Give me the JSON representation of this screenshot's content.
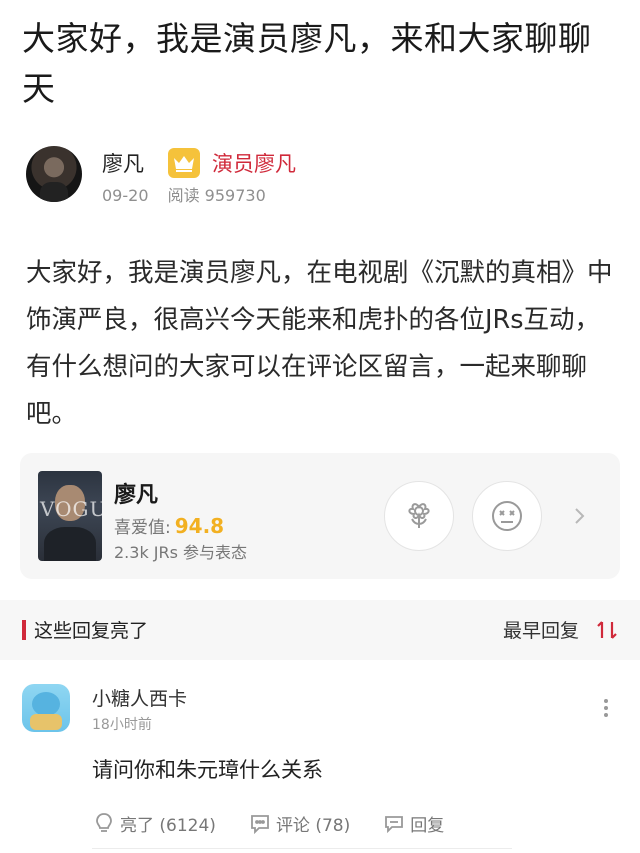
{
  "post": {
    "title": "大家好，我是演员廖凡，来和大家聊聊天",
    "author": {
      "name": "廖凡",
      "badge_icon": "crown-icon",
      "verified_title": "演员廖凡",
      "date": "09-20",
      "reads": "阅读 959730"
    },
    "body": "大家好，我是演员廖凡，在电视剧《沉默的真相》中饰演严良，很高兴今天能来和虎扑的各位JRs互动，有什么想问的大家可以在评论区留言，一起来聊聊吧。"
  },
  "rating_card": {
    "name": "廖凡",
    "like_label": "喜爱值:",
    "like_score": "94.8",
    "votes": "2.3k JRs 参与表态",
    "photo_text": "VOGUE",
    "buttons": [
      "flower-icon",
      "dizzy-face-icon"
    ],
    "chevron": "chevron-right-icon"
  },
  "comments_section": {
    "title": "这些回复亮了",
    "sort_label": "最早回复",
    "sort_icon": "sort-arrows-icon",
    "accent": "#d0293a"
  },
  "comments": [
    {
      "user": "小糖人西卡",
      "time": "18小时前",
      "text": "请问你和朱元璋什么关系",
      "likes": "亮了 (6124)",
      "replies": "评论 (78)",
      "reply": "回复"
    }
  ],
  "colors": {
    "accent_red": "#d0293a",
    "score_gold": "#f2b021",
    "badge_gold": "#f5c23b"
  }
}
